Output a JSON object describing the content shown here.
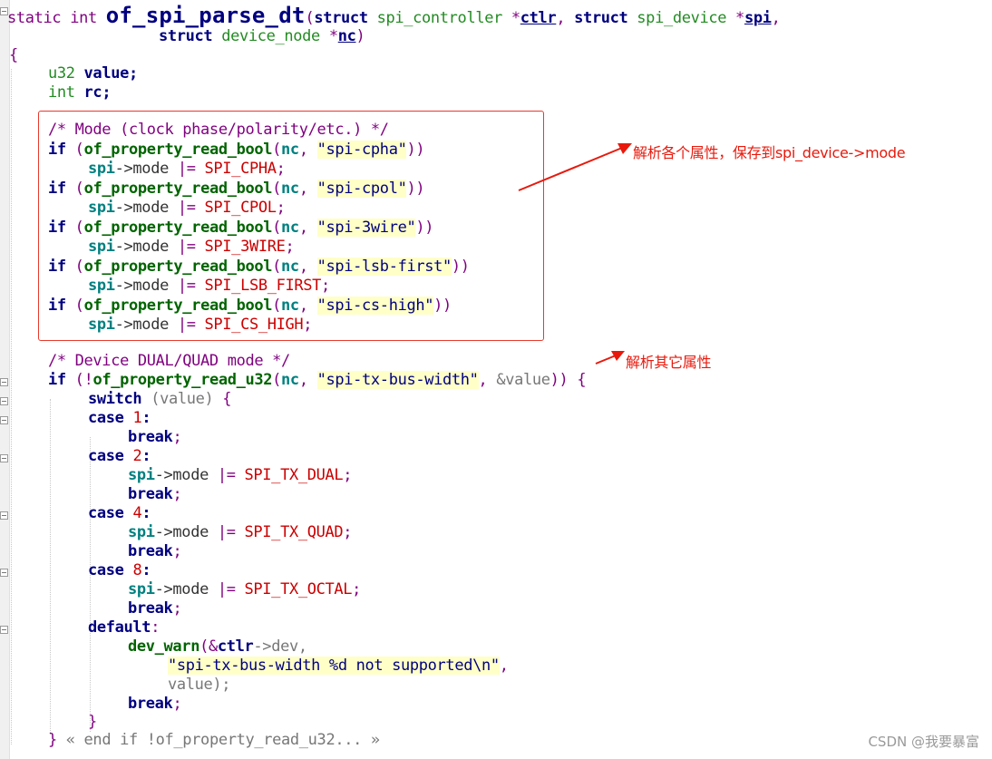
{
  "code": {
    "static_kw": "static",
    "int_kw": "int",
    "func_name": "of_spi_parse_dt",
    "paren_open": "(",
    "struct_kw": "struct",
    "spi_controller_type": "spi_controller",
    "star": "*",
    "ctlr": "ctlr",
    "comma": ",",
    "spi_device_type": "spi_device",
    "spi": "spi",
    "device_node_type": "device_node",
    "nc": "nc",
    "paren_close": ")",
    "brace_open": "{",
    "brace_close": "}",
    "u32": "u32",
    "value_decl": "value;",
    "rc_decl": "rc;",
    "comment_mode": "/* Mode (clock phase/polarity/etc.) */",
    "comment_dual": "/* Device DUAL/QUAD mode */",
    "if_kw": "if",
    "read_bool": "of_property_read_bool",
    "read_u32": "of_property_read_u32",
    "arrow_mode": "->mode",
    "or_assign": "|=",
    "semicolon": ";",
    "str_cpha": "\"spi-cpha\"",
    "str_cpol": "\"spi-cpol\"",
    "str_3wire": "\"spi-3wire\"",
    "str_lsb": "\"spi-lsb-first\"",
    "str_cshigh": "\"spi-cs-high\"",
    "str_txbw": "\"spi-tx-bus-width\"",
    "mac_cpha": "SPI_CPHA",
    "mac_cpol": "SPI_CPOL",
    "mac_3wire": "SPI_3WIRE",
    "mac_lsb": "SPI_LSB_FIRST",
    "mac_cshigh": "SPI_CS_HIGH",
    "mac_txdual": "SPI_TX_DUAL",
    "mac_txquad": "SPI_TX_QUAD",
    "mac_txoctal": "SPI_TX_OCTAL",
    "not_op": "!",
    "amp_value": "&value",
    "switch_kw": "switch",
    "switch_arg": "(value)",
    "case_kw": "case",
    "num_1": "1",
    "num_2": "2",
    "num_4": "4",
    "num_8": "8",
    "colon": ":",
    "break_kw": "break",
    "default_kw": "default",
    "dev_warn": "dev_warn",
    "amp": "&",
    "arrow_dev": "->dev,",
    "str_warn": "\"spi-tx-bus-width %d not supported\\n\"",
    "value_close": "value);",
    "end_if": "« end if !of_property_read_u32... »"
  },
  "annotations": {
    "mode_note": "解析各个属性，保存到spi_device->mode",
    "other_note": "解析其它属性",
    "arrow_color": "#e8190c"
  },
  "watermark": "CSDN @我要暴富"
}
